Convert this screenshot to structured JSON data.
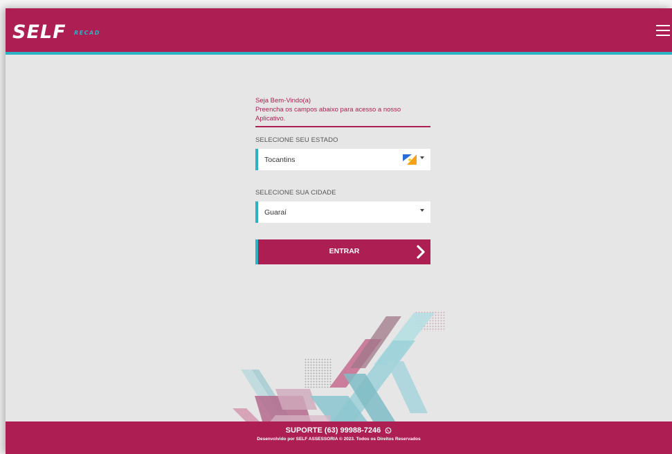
{
  "header": {
    "logo_text": "SELF",
    "logo_sub": "RECAD",
    "menu_icon": "hamburger-menu-icon"
  },
  "form": {
    "welcome_title": "Seja Bem-Vindo(a)",
    "welcome_subtitle": "Preencha os campos abaixo para acesso a nosso Aplicativo.",
    "state_label": "SELECIONE SEU ESTADO",
    "state_value": "Tocantins",
    "state_flag_icon": "tocantins-flag-icon",
    "city_label": "SELECIONE SUA CIDADE",
    "city_value": "Guaraí",
    "enter_label": "ENTRAR",
    "enter_icon": "chevron-right-icon"
  },
  "footer": {
    "support": "SUPORTE (63) 99988-7246",
    "support_icon": "whatsapp-icon",
    "copyright": "Desenvolvido por SELF ASSESSORIA © 2023. Todos os Direitos Reservados"
  },
  "colors": {
    "brand": "#ad1f53",
    "accent": "#2bb3c5",
    "background": "#e6e6e6"
  }
}
